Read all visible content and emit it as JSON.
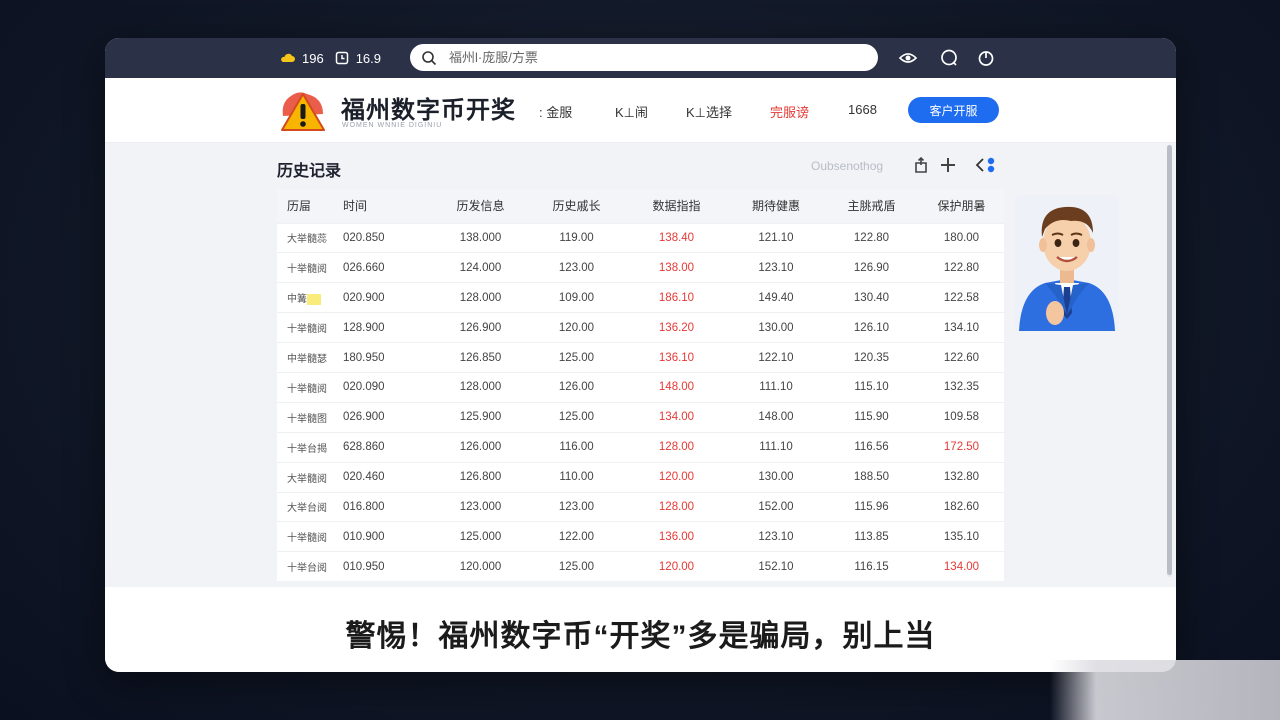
{
  "topbar": {
    "status_a": "196",
    "status_b": "16.9",
    "search_placeholder": "福州l·庞服/方票"
  },
  "header": {
    "brand": "福州数字币开奖",
    "brand_sub": "WOMEN WNNIE DIGINIU",
    "nav": [
      {
        "label": ": 金服"
      },
      {
        "label": "K⊥闹"
      },
      {
        "label": "K⊥选择"
      },
      {
        "label": "完服谤"
      },
      {
        "label": "1668"
      }
    ],
    "cta_label": "客户开服"
  },
  "section": {
    "title": "历史记录",
    "toolbar_placeholder": "Oubsenothog"
  },
  "table": {
    "columns": [
      "历屇",
      "时间",
      "历发信息",
      "历史戚长",
      "数据指指",
      "期待健惠",
      "主脁戒盾",
      "保护朋暑"
    ],
    "rows": [
      [
        "大举髓蕊",
        "020.850",
        "138.000",
        "119.00",
        "138.40",
        "121.10",
        "122.80",
        "180.00"
      ],
      [
        "十举髓阅",
        "026.660",
        "124.000",
        "123.00",
        "138.00",
        "123.10",
        "126.90",
        "122.80"
      ],
      [
        "中篝",
        "020.900",
        "128.000",
        "109.00",
        "186.10",
        "149.40",
        "130.40",
        "122.58"
      ],
      [
        "十举髓阅",
        "128.900",
        "126.900",
        "120.00",
        "136.20",
        "130.00",
        "126.10",
        "134.10"
      ],
      [
        "中举髓瑟",
        "180.950",
        "126.850",
        "125.00",
        "136.10",
        "122.10",
        "120.35",
        "122.60"
      ],
      [
        "十举髓阅",
        "020.090",
        "128.000",
        "126.00",
        "148.00",
        "111.10",
        "115.10",
        "132.35"
      ],
      [
        "十举髓图",
        "026.900",
        "125.900",
        "125.00",
        "134.00",
        "148.00",
        "115.90",
        "109.58"
      ],
      [
        "十举台揭",
        "628.860",
        "126.000",
        "116.00",
        "128.00",
        "111.10",
        "116.56",
        "172.50"
      ],
      [
        "大举髓阅",
        "020.460",
        "126.800",
        "110.00",
        "120.00",
        "130.00",
        "188.50",
        "132.80"
      ],
      [
        "大举台阅",
        "016.800",
        "123.000",
        "123.00",
        "128.00",
        "152.00",
        "115.96",
        "182.60"
      ],
      [
        "十举髓阅",
        "010.900",
        "125.000",
        "122.00",
        "136.00",
        "123.10",
        "113.85",
        "135.10"
      ],
      [
        "十举台阅",
        "010.950",
        "120.000",
        "125.00",
        "120.00",
        "152.10",
        "116.15",
        "134.00"
      ]
    ],
    "red_col": 4,
    "red_last": [
      7,
      11
    ]
  },
  "caption": "警惕！福州数字币“开奖”多是骗局，别上当",
  "colors": {
    "topbar": "#2b3247",
    "accent_blue": "#1e6cf0",
    "red": "#e53935"
  }
}
